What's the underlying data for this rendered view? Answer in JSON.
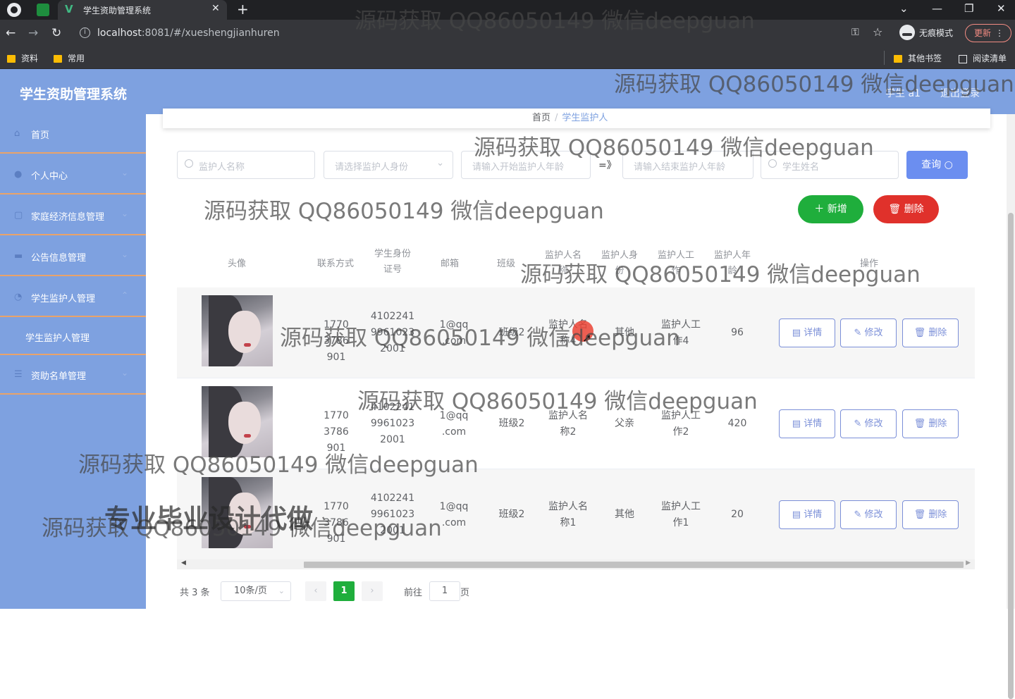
{
  "browser": {
    "tab_title": "学生资助管理系统",
    "url_host": "localhost",
    "url_rest": ":8081/#/xueshengjianhuren",
    "incognito_label": "无痕模式",
    "update_label": "更新",
    "bookmarks": [
      "资料",
      "常用",
      "其他书签",
      "阅读清单"
    ]
  },
  "header": {
    "app_title": "学生资助管理系统",
    "user_name": "学生 a1",
    "logout_label": "退出登录"
  },
  "sidebar": {
    "items": [
      {
        "label": "首页",
        "icon": "home-icon",
        "arrow": false
      },
      {
        "label": "个人中心",
        "icon": "user-icon",
        "arrow": true
      },
      {
        "label": "家庭经济信息管理",
        "icon": "document-icon",
        "arrow": true
      },
      {
        "label": "公告信息管理",
        "icon": "briefcase-icon",
        "arrow": true
      },
      {
        "label": "学生监护人管理",
        "icon": "clock-icon",
        "arrow": true
      }
    ],
    "subitem": "学生监护人管理",
    "last_item": {
      "label": "资助名单管理",
      "icon": "list-icon",
      "arrow": true
    }
  },
  "breadcrumb": {
    "home": "首页",
    "current": "学生监护人"
  },
  "search": {
    "guardian_name_placeholder": "监护人名称",
    "guardian_identity_placeholder": "请选择监护人身份",
    "start_age_placeholder": "请输入开始监护人年龄",
    "range_separator": "=》",
    "end_age_placeholder": "请输入结束监护人年龄",
    "student_name_placeholder": "学生姓名",
    "query_label": "查询"
  },
  "actions": {
    "add_label": "新增",
    "delete_label": "删除"
  },
  "table": {
    "columns": [
      "头像",
      "联系方式",
      "学生身份证号",
      "邮箱",
      "班级",
      "监护人名称",
      "监护人身份",
      "监护人工作",
      "监护人年龄",
      "操作"
    ],
    "rows": [
      {
        "phone": "17703786901",
        "id_card": "410224199610232001",
        "email": "1@qq.com",
        "class": "班级2",
        "guardian_name": "监护人名称4",
        "identity": "其他",
        "work": "监护人工作4",
        "age": "96"
      },
      {
        "phone": "17703786901",
        "id_card": "410224199610232001",
        "email": "1@qq.com",
        "class": "班级2",
        "guardian_name": "监护人名称2",
        "identity": "父亲",
        "work": "监护人工作2",
        "age": "420"
      },
      {
        "phone": "17703786901",
        "id_card": "410224199610232001",
        "email": "1@qq.com",
        "class": "班级2",
        "guardian_name": "监护人名称1",
        "identity": "其他",
        "work": "监护人工作1",
        "age": "20"
      }
    ],
    "row_actions": {
      "detail": "详情",
      "edit": "修改",
      "delete": "删除"
    }
  },
  "pagination": {
    "total": "共 3 条",
    "page_size": "10条/页",
    "current_page": "1",
    "goto_prefix": "前往",
    "goto_value": "1",
    "goto_suffix": "页"
  },
  "overlays": {
    "watermark": "源码获取 QQ86050149 微信deepguan",
    "stamp": "专业毕业设计代做"
  },
  "colors": {
    "sidebar": "#7ea1e0",
    "query_button": "#6b8ef0",
    "add_button": "#1fae3c",
    "delete_button": "#e0312b",
    "row_action": "#7b8fd8"
  }
}
